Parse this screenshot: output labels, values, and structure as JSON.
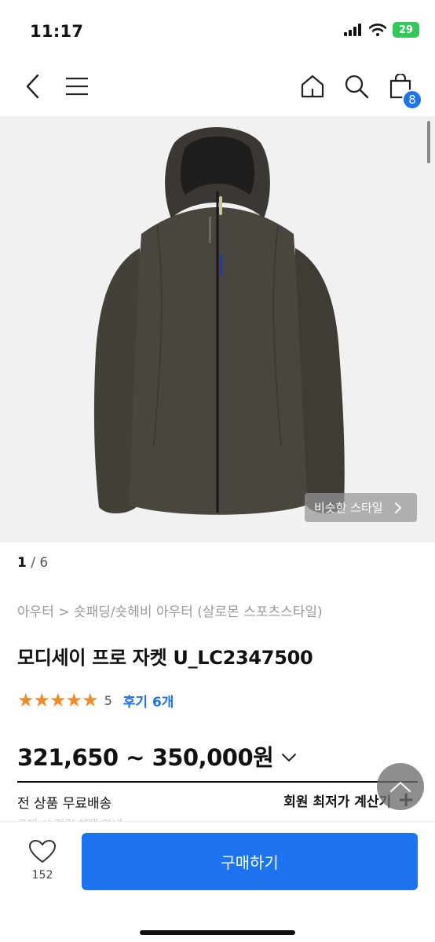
{
  "status_bar": {
    "time": "11:17",
    "battery": "29"
  },
  "header": {
    "cart_count": "8"
  },
  "gallery": {
    "similar_style_label": "비슷한 스타일",
    "current_page": "1",
    "separator": " / ",
    "total_pages": "6"
  },
  "product": {
    "breadcrumb": "아우터 > 숏패딩/숏헤비 아우터 (살로몬 스포츠스타일)",
    "title": "모디세이 프로 자켓 U_LC2347500",
    "stars": "★★★★★",
    "rating": "5",
    "review_link": "후기 6개",
    "price_range": "321,650 ~ 350,000원",
    "shipping": "전 상품 무료배송",
    "member_price_label": "회원 최저가 계산기",
    "member_price_icon": "+",
    "cut_off_text": "구매 시 적립 혜택 안내"
  },
  "bottom_bar": {
    "like_count": "152",
    "buy_label": "구매하기"
  },
  "colors": {
    "accent": "#1e73f0",
    "star": "#f08c2e",
    "battery": "#34c759",
    "image_bg": "#f1f1f1",
    "jacket": "#46433d"
  }
}
